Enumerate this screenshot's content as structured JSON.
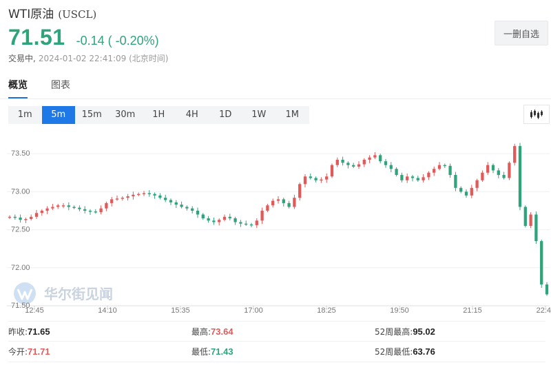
{
  "header": {
    "name": "WTI原油",
    "code": "(USCL)",
    "price": "71.51",
    "change": "-0.14 ( -0.20%)",
    "status": "交易中,",
    "timestamp": "2024-01-02 22:41:09 (北京时间)"
  },
  "favorite_button": {
    "label": "一删自选"
  },
  "tabs": [
    {
      "label": "概览",
      "active": true
    },
    {
      "label": "图表",
      "active": false
    }
  ],
  "periods": [
    {
      "label": "1m",
      "active": false
    },
    {
      "label": "5m",
      "active": true
    },
    {
      "label": "15m",
      "active": false
    },
    {
      "label": "30m",
      "active": false
    },
    {
      "label": "1H",
      "active": false
    },
    {
      "label": "4H",
      "active": false
    },
    {
      "label": "1D",
      "active": false
    },
    {
      "label": "1W",
      "active": false
    },
    {
      "label": "1M",
      "active": false
    }
  ],
  "chart_type_icon": "candlestick-icon",
  "watermark": {
    "text": "华尔街见闻"
  },
  "colors": {
    "up": "#e15a5a",
    "down": "#2fa37a",
    "accent": "#1e78e6"
  },
  "chart_data": {
    "type": "candlestick",
    "y_ticks": [
      "73.50",
      "73.00",
      "72.50",
      "72.00",
      "71.50"
    ],
    "ylim": [
      71.5,
      73.8
    ],
    "x_ticks": [
      "12:45",
      "14:10",
      "15:35",
      "17:00",
      "18:25",
      "19:50",
      "21:15",
      "22:4"
    ],
    "grid": true,
    "closes": [
      72.67,
      72.66,
      72.63,
      72.64,
      72.67,
      72.72,
      72.75,
      72.78,
      72.8,
      72.82,
      72.82,
      72.8,
      72.79,
      72.77,
      72.75,
      72.74,
      72.73,
      72.78,
      72.85,
      72.9,
      72.91,
      72.92,
      72.94,
      72.96,
      72.97,
      72.98,
      72.97,
      72.95,
      72.92,
      72.89,
      72.86,
      72.83,
      72.8,
      72.78,
      72.75,
      72.7,
      72.65,
      72.62,
      72.6,
      72.63,
      72.67,
      72.65,
      72.6,
      72.58,
      72.57,
      72.56,
      72.62,
      72.75,
      72.82,
      72.88,
      72.9,
      72.85,
      72.8,
      72.92,
      73.1,
      73.2,
      73.18,
      73.15,
      73.16,
      73.2,
      73.35,
      73.42,
      73.38,
      73.35,
      73.33,
      73.36,
      73.42,
      73.45,
      73.48,
      73.4,
      73.35,
      73.3,
      73.22,
      73.15,
      73.2,
      73.18,
      73.15,
      73.19,
      73.25,
      73.3,
      73.35,
      73.34,
      73.22,
      73.05,
      73.0,
      72.95,
      73.05,
      73.15,
      73.25,
      73.35,
      73.28,
      73.22,
      73.18,
      73.38,
      73.6,
      72.8,
      72.55,
      72.7,
      72.35,
      71.78,
      71.65
    ]
  },
  "stats": [
    {
      "label": "昨收:",
      "value": "71.65",
      "tone": "dark"
    },
    {
      "label": "最高:",
      "value": "73.64",
      "tone": "red"
    },
    {
      "label": "52周最高:",
      "value": "95.02",
      "tone": "dark"
    },
    {
      "label": "今开:",
      "value": "71.71",
      "tone": "red"
    },
    {
      "label": "最低:",
      "value": "71.43",
      "tone": "green"
    },
    {
      "label": "52周最低:",
      "value": "63.76",
      "tone": "dark"
    }
  ]
}
